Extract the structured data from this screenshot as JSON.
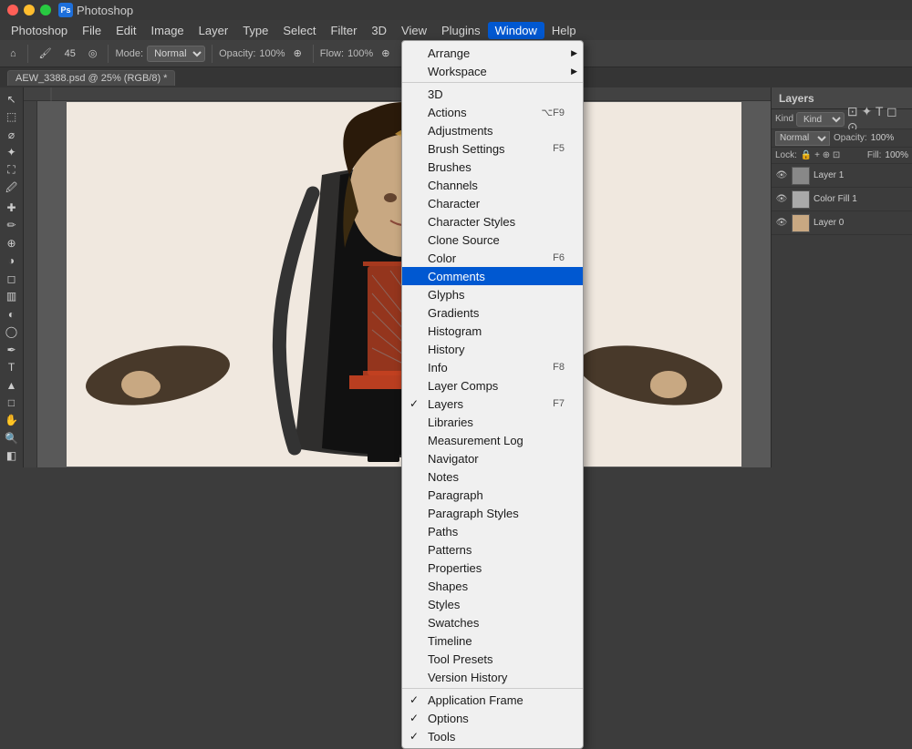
{
  "titlebar": {
    "app_name": "Photoshop"
  },
  "menubar": {
    "items": [
      {
        "label": "Photoshop",
        "id": "photoshop"
      },
      {
        "label": "File",
        "id": "file"
      },
      {
        "label": "Edit",
        "id": "edit"
      },
      {
        "label": "Image",
        "id": "image"
      },
      {
        "label": "Layer",
        "id": "layer"
      },
      {
        "label": "Type",
        "id": "type"
      },
      {
        "label": "Select",
        "id": "select"
      },
      {
        "label": "Filter",
        "id": "filter"
      },
      {
        "label": "3D",
        "id": "3d"
      },
      {
        "label": "View",
        "id": "view"
      },
      {
        "label": "Plugins",
        "id": "plugins"
      },
      {
        "label": "Window",
        "id": "window",
        "active": true
      },
      {
        "label": "Help",
        "id": "help"
      }
    ]
  },
  "toolbar": {
    "mode_label": "Mode:",
    "mode_value": "Normal",
    "opacity_label": "Opacity:",
    "opacity_value": "100%",
    "flow_label": "Flow:",
    "flow_value": "100%"
  },
  "tab": {
    "filename": "AEW_3388.psd @ 25% (RGB/8) *"
  },
  "window_menu": {
    "items": [
      {
        "label": "Arrange",
        "has_submenu": true
      },
      {
        "label": "Workspace",
        "has_submenu": true
      },
      {
        "separator": true
      },
      {
        "label": "3D"
      },
      {
        "label": "Actions",
        "shortcut": "⌥F9"
      },
      {
        "label": "Adjustments"
      },
      {
        "label": "Brush Settings",
        "shortcut": "F5"
      },
      {
        "label": "Brushes"
      },
      {
        "label": "Channels"
      },
      {
        "label": "Character"
      },
      {
        "label": "Character Styles"
      },
      {
        "label": "Clone Source"
      },
      {
        "label": "Color",
        "shortcut": "F6"
      },
      {
        "label": "Comments",
        "highlighted": true
      },
      {
        "label": "Glyphs"
      },
      {
        "label": "Gradients"
      },
      {
        "label": "Histogram"
      },
      {
        "label": "History"
      },
      {
        "label": "Info",
        "shortcut": "F8"
      },
      {
        "label": "Layer Comps"
      },
      {
        "label": "Layers",
        "checked": true,
        "shortcut": "F7"
      },
      {
        "label": "Libraries"
      },
      {
        "label": "Measurement Log"
      },
      {
        "label": "Navigator"
      },
      {
        "label": "Notes"
      },
      {
        "label": "Paragraph"
      },
      {
        "label": "Paragraph Styles"
      },
      {
        "label": "Paths"
      },
      {
        "label": "Patterns"
      },
      {
        "label": "Properties"
      },
      {
        "label": "Shapes"
      },
      {
        "label": "Styles"
      },
      {
        "label": "Swatches"
      },
      {
        "label": "Timeline"
      },
      {
        "label": "Tool Presets"
      },
      {
        "label": "Version History"
      },
      {
        "separator": true
      },
      {
        "label": "Application Frame",
        "checked": true
      },
      {
        "label": "Options",
        "checked": true
      },
      {
        "label": "Tools",
        "checked": true
      }
    ]
  },
  "layers_panel": {
    "title": "Layers",
    "kind_label": "Kind",
    "mode_value": "Normal",
    "opacity_label": "Opacity:",
    "opacity_value": "100%",
    "lock_label": "Lock:",
    "fill_label": "Fill:",
    "fill_value": "100%",
    "layers": [
      {
        "name": "Layer 1",
        "visible": true,
        "type": "image"
      },
      {
        "name": "Color Fill 1",
        "visible": true,
        "type": "fill"
      },
      {
        "name": "Layer 0",
        "visible": true,
        "type": "image"
      }
    ]
  }
}
